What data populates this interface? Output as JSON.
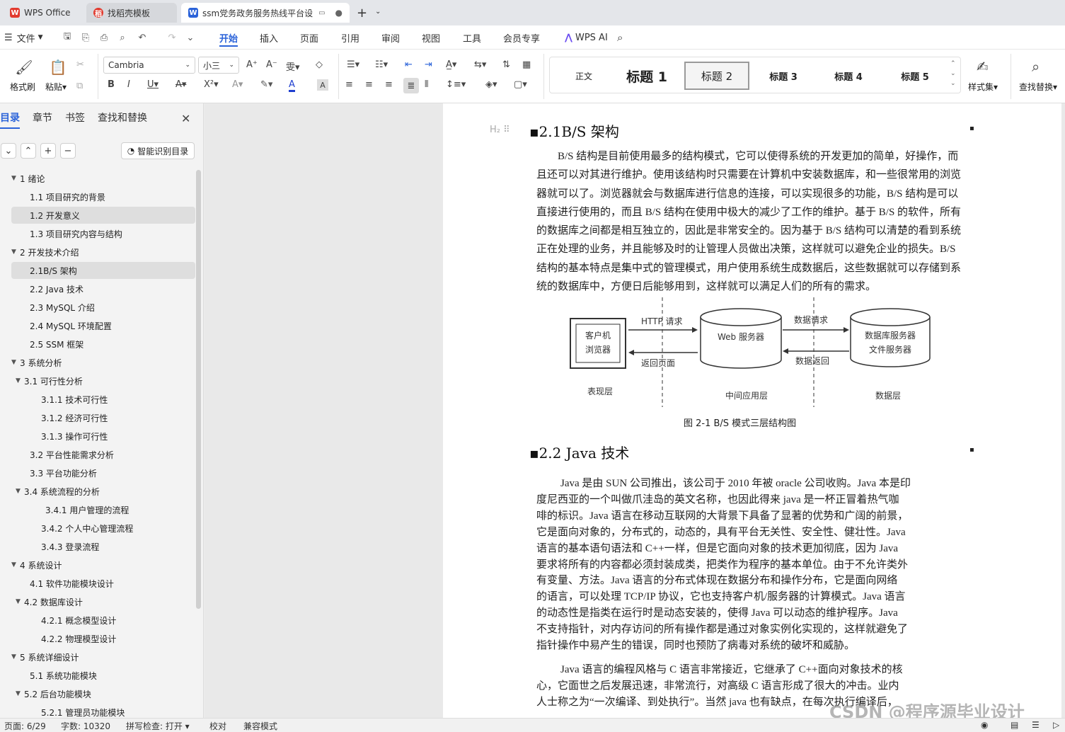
{
  "tabs": [
    {
      "label": "WPS Office",
      "icon": "wps-logo-icon"
    },
    {
      "label": "找稻壳模板",
      "icon": "docer-icon"
    },
    {
      "label": "ssm党务政务服务热线平台设",
      "icon": "word-doc-icon"
    }
  ],
  "menu": {
    "file": "文件",
    "items": [
      "开始",
      "插入",
      "页面",
      "引用",
      "审阅",
      "视图",
      "工具",
      "会员专享"
    ],
    "wps_ai": "WPS AI"
  },
  "ribbon": {
    "format_painter": "格式刷",
    "paste": "粘贴",
    "font": "Cambria",
    "size": "小三",
    "styles": [
      "正文",
      "标题 1",
      "标题 2",
      "标题 3",
      "标题 4",
      "标题 5"
    ],
    "style_set": "样式集",
    "find_replace": "查找替换"
  },
  "sidebar": {
    "tabs": [
      "目录",
      "章节",
      "书签",
      "查找和替换"
    ],
    "smart_btn": "智能识别目录",
    "toc": [
      {
        "label": "1 绪论",
        "level": 0,
        "expand": true
      },
      {
        "label": "1.1 项目研究的背景",
        "level": 1
      },
      {
        "label": "1.2 开发意义",
        "level": 1,
        "hl": true
      },
      {
        "label": "1.3 项目研究内容与结构",
        "level": 1
      },
      {
        "label": "2 开发技术介绍",
        "level": 0,
        "expand": true
      },
      {
        "label": "2.1B/S 架构",
        "level": 1,
        "hl": true
      },
      {
        "label": "2.2 Java 技术",
        "level": 1
      },
      {
        "label": "2.3 MySQL  介绍",
        "level": 1
      },
      {
        "label": "2.4 MySQL 环境配置",
        "level": 1
      },
      {
        "label": "2.5 SSM 框架",
        "level": 1
      },
      {
        "label": "3 系统分析",
        "level": 0,
        "expand": true
      },
      {
        "label": "3.1 可行性分析",
        "level": 1,
        "expand": true
      },
      {
        "label": "3.1.1 技术可行性",
        "level": 2
      },
      {
        "label": "3.1.2 经济可行性",
        "level": 2
      },
      {
        "label": "3.1.3 操作可行性",
        "level": 2
      },
      {
        "label": "3.2 平台性能需求分析",
        "level": 1
      },
      {
        "label": "3.3 平台功能分析",
        "level": 1
      },
      {
        "label": "3.4 系统流程的分析",
        "level": 1,
        "expand": true
      },
      {
        "label": "3.4.1  用户管理的流程",
        "level": 2.4
      },
      {
        "label": "3.4.2  个人中心管理流程",
        "level": 2
      },
      {
        "label": "3.4.3  登录流程",
        "level": 2
      },
      {
        "label": "4 系统设计",
        "level": 0,
        "expand": true
      },
      {
        "label": "4.1  软件功能模块设计",
        "level": 1
      },
      {
        "label": "4.2  数据库设计",
        "level": 1,
        "expand": true
      },
      {
        "label": "4.2.1  概念模型设计",
        "level": 2
      },
      {
        "label": "4.2.2  物理模型设计",
        "level": 2
      },
      {
        "label": "5 系统详细设计",
        "level": 0,
        "expand": true
      },
      {
        "label": "5.1 系统功能模块",
        "level": 1
      },
      {
        "label": "5.2 后台功能模块",
        "level": 1,
        "expand": true
      },
      {
        "label": "5.2.1 管理员功能模块",
        "level": 2
      }
    ]
  },
  "doc": {
    "h_bs": "2.1B/S 架构",
    "bs_lines": [
      "B/S 结构是目前使用最多的结构模式，它可以使得系统的开发更加的简单，好操作，而",
      "且还可以对其进行维护。使用该结构时只需要在计算机中安装数据库，和一些很常用的浏览",
      "器就可以了。浏览器就会与数据库进行信息的连接，可以实现很多的功能，B/S 结构是可以",
      "直接进行使用的，而且 B/S 结构在使用中极大的减少了工作的维护。基于 B/S 的软件，所有",
      "的数据库之间都是相互独立的，因此是非常安全的。因为基于 B/S 结构可以清楚的看到系统",
      "正在处理的业务，并且能够及时的让管理人员做出决策，这样就可以避免企业的损失。B/S",
      "结构的基本特点是集中式的管理模式，用户使用系统生成数据后，这些数据就可以存储到系",
      "统的数据库中，方便日后能够用到，这样就可以满足人们的所有的需求。"
    ],
    "diagram": {
      "client": [
        "客户机",
        "浏览器"
      ],
      "http": "HTTP 请求",
      "back": "返回页面",
      "web": "Web 服务器",
      "req": "数据请求",
      "ret": "数据返回",
      "db": [
        "数据库服务器",
        "文件服务器"
      ],
      "layers": [
        "表现层",
        "中间应用层",
        "数据层"
      ]
    },
    "caption": "图 2-1  B/S 模式三层结构图",
    "h_java": "2.2 Java 技术",
    "java_lines": [
      "Java 是由 SUN 公司推出，该公司于 2010 年被 oracle 公司收购。Java 本是印",
      "度尼西亚的一个叫做爪洼岛的英文名称，也因此得来 java 是一杯正冒着热气咖",
      "啡的标识。Java 语言在移动互联网的大背景下具备了显著的优势和广阔的前景，",
      "它是面向对象的，分布式的，动态的，具有平台无关性、安全性、健壮性。Java",
      "语言的基本语句语法和 C++一样，但是它面向对象的技术更加彻底，因为 Java",
      "要求将所有的内容都必须封装成类，把类作为程序的基本单位。由于不允许类外",
      "有变量、方法。Java 语言的分布式体现在数据分布和操作分布，它是面向网络",
      "的语言，可以处理 TCP/IP 协议，它也支持客户机/服务器的计算模式。Java 语言",
      "的动态性是指类在运行时是动态安装的，使得 Java 可以动态的维护程序。Java",
      "不支持指针，对内存访问的所有操作都是通过对象实例化实现的，这样就避免了",
      "指针操作中易产生的错误，同时也预防了病毒对系统的破坏和威胁。"
    ],
    "java2_lines": [
      "Java 语言的编程风格与 C 语言非常接近，它继承了 C++面向对象技术的核",
      "心，它面世之后发展迅速，非常流行，对高级 C 语言形成了很大的冲击。业内",
      "人士称之为“一次编译、到处执行”。当然 java 也有缺点，在每次执行编译后，"
    ],
    "watermark": "CSDN @程序源毕业设计"
  },
  "status": {
    "page": "页面: 6/29",
    "words": "字数: 10320",
    "spell": "拼写检查: 打开",
    "proof": "校对",
    "compat": "兼容模式"
  }
}
